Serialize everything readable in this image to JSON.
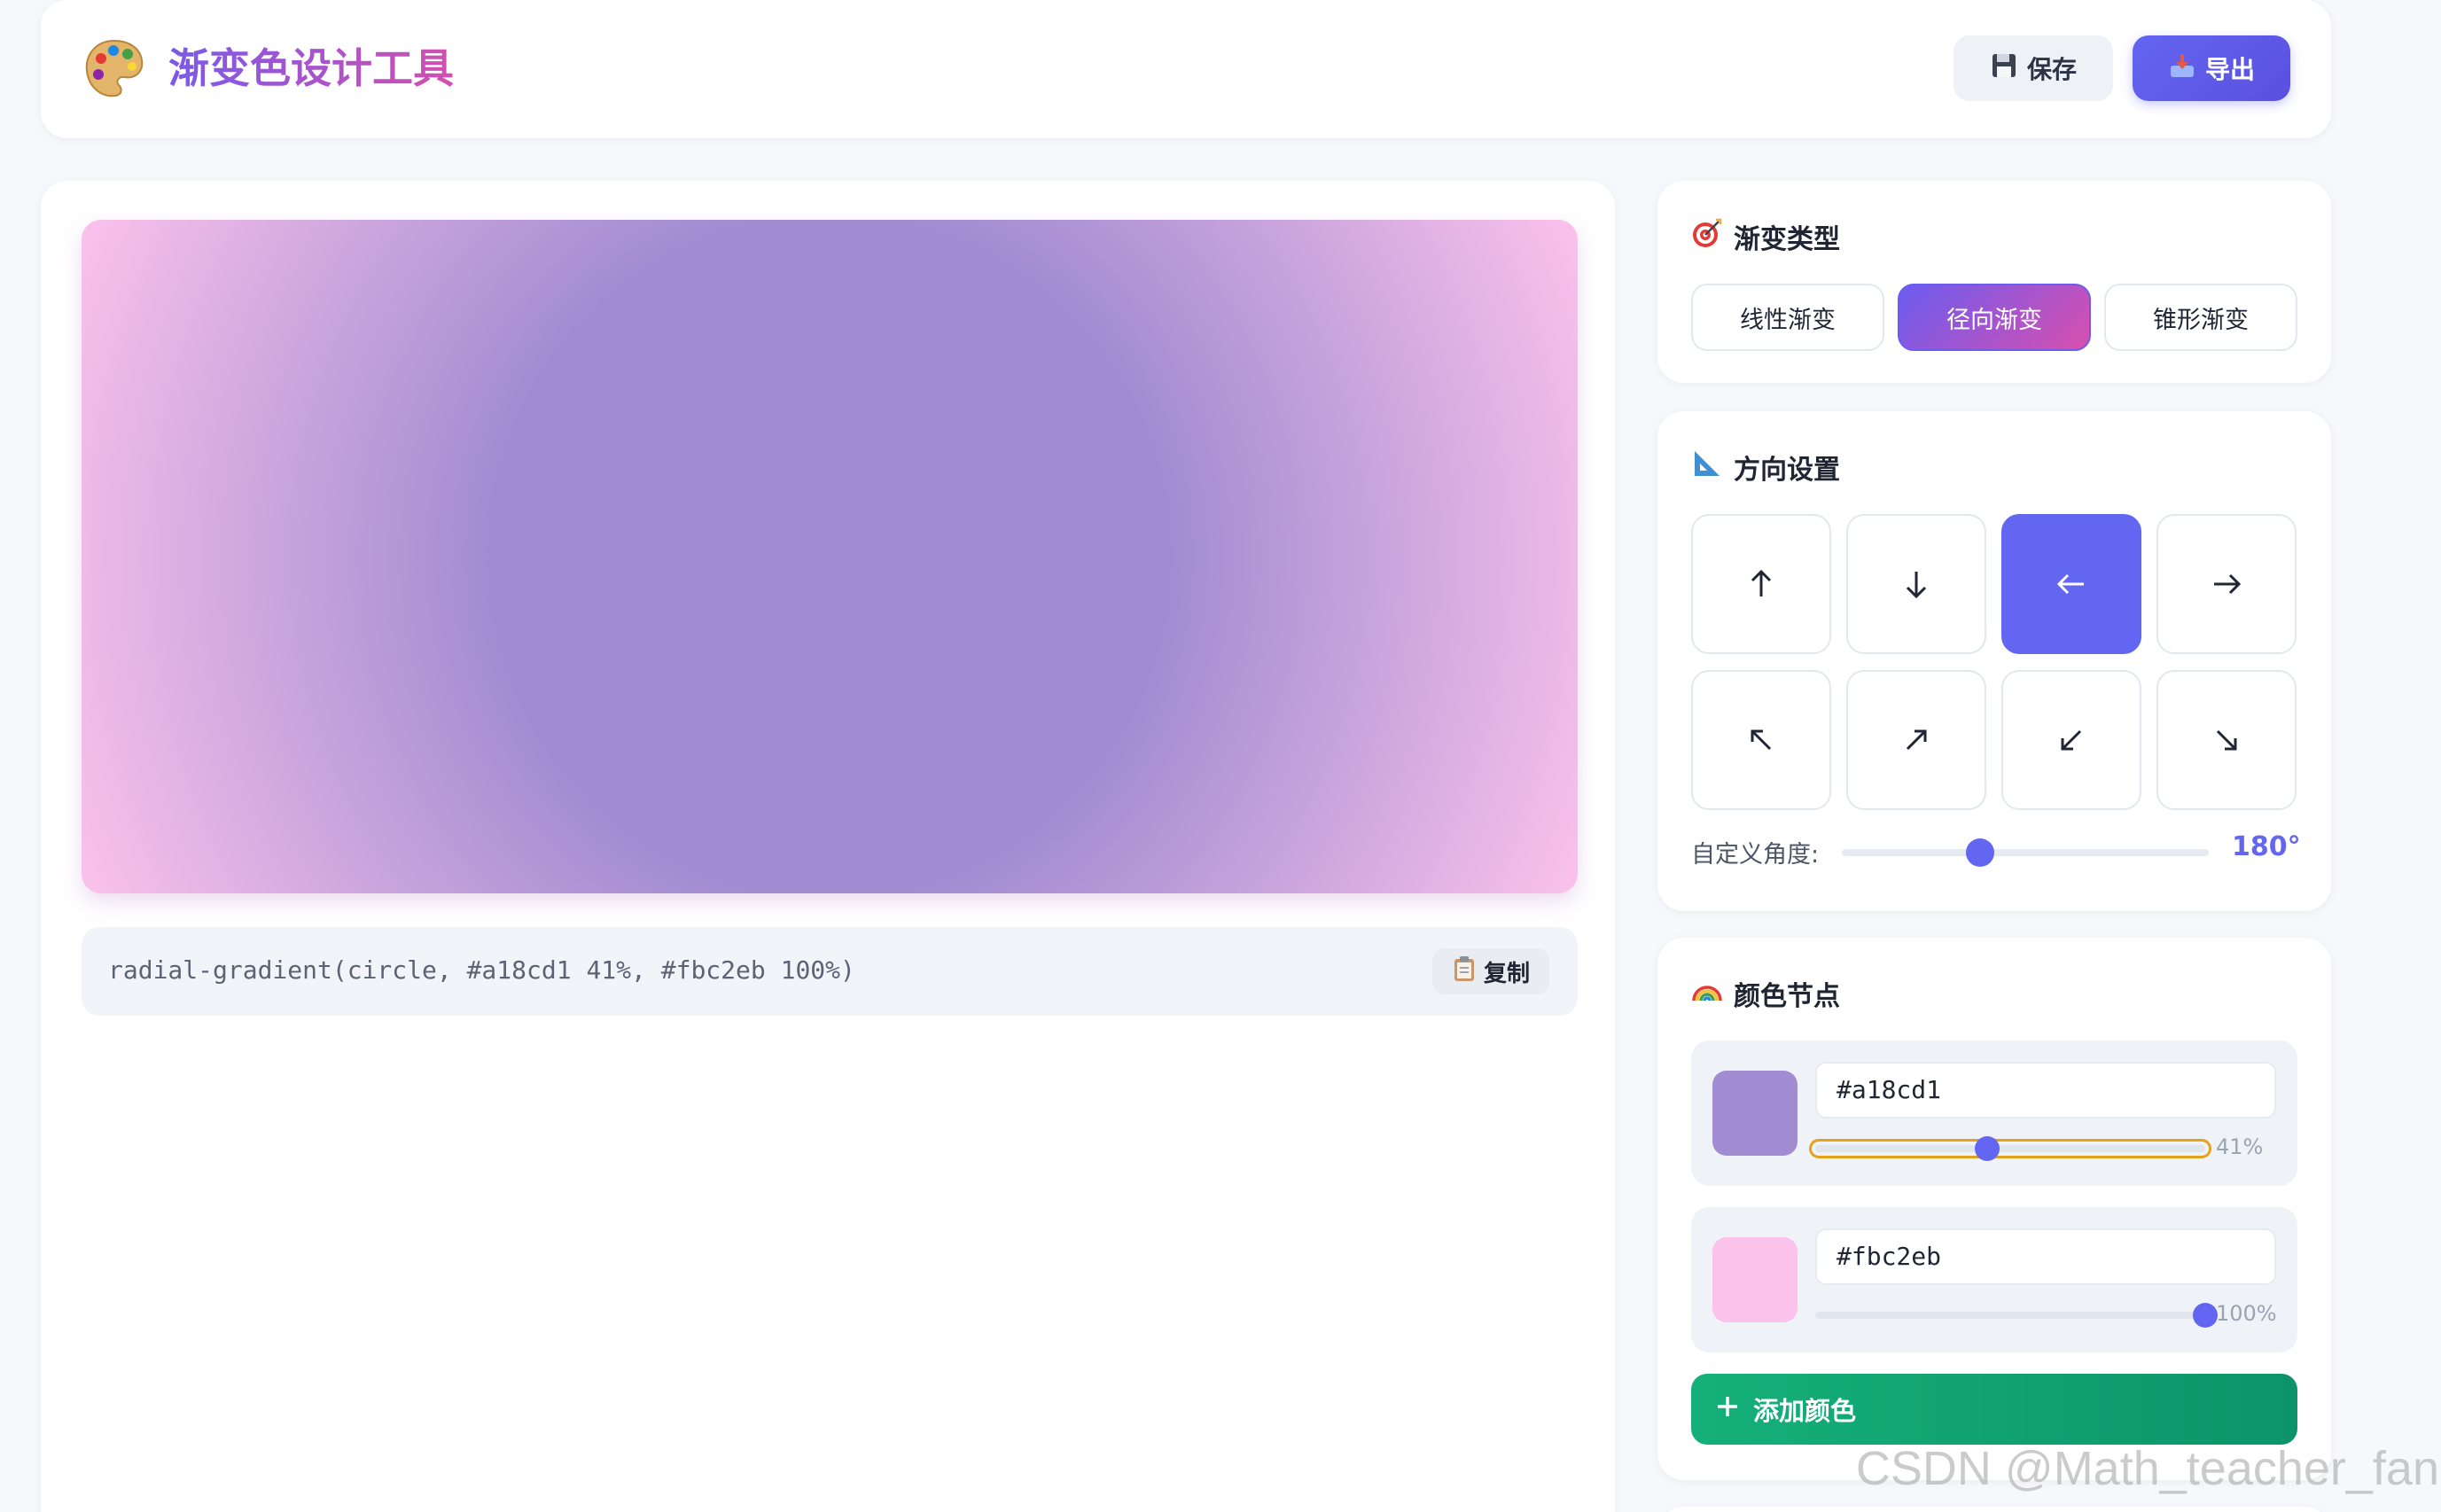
{
  "app": {
    "title": "渐变色设计工具",
    "logo_icon": "palette-icon"
  },
  "header": {
    "save_label": "保存",
    "save_icon": "floppy-disk-icon",
    "export_label": "导出",
    "export_icon": "tray-download-icon"
  },
  "preview": {
    "css_code": "radial-gradient(circle, #a18cd1 41%, #fbc2eb 100%)",
    "copy_label": "复制",
    "copy_icon": "clipboard-icon"
  },
  "gradient_type": {
    "title": "渐变类型",
    "title_icon": "target-icon",
    "options": [
      "线性渐变",
      "径向渐变",
      "锥形渐变"
    ],
    "selected": "径向渐变"
  },
  "direction": {
    "title": "方向设置",
    "title_icon": "triangle-ruler-icon",
    "arrows": [
      "↑",
      "↓",
      "←",
      "→",
      "↖",
      "↗",
      "↙",
      "↘"
    ],
    "selected": "←",
    "angle_label": "自定义角度:",
    "angle_value": "180°",
    "angle_degrees": 180
  },
  "color_stops": {
    "title": "颜色节点",
    "title_icon": "rainbow-icon",
    "stops": [
      {
        "hex": "#a18cd1",
        "percent_label": "41%",
        "percent": 41
      },
      {
        "hex": "#fbc2eb",
        "percent_label": "100%",
        "percent": 100
      }
    ],
    "add_label": "添加颜色",
    "add_icon": "plus-icon"
  },
  "colors": {
    "accent": "#6366f1",
    "success": "#10b981",
    "stop1": "#a18cd1",
    "stop2": "#fbc2eb"
  },
  "watermark": "CSDN @Math_teacher_fan"
}
